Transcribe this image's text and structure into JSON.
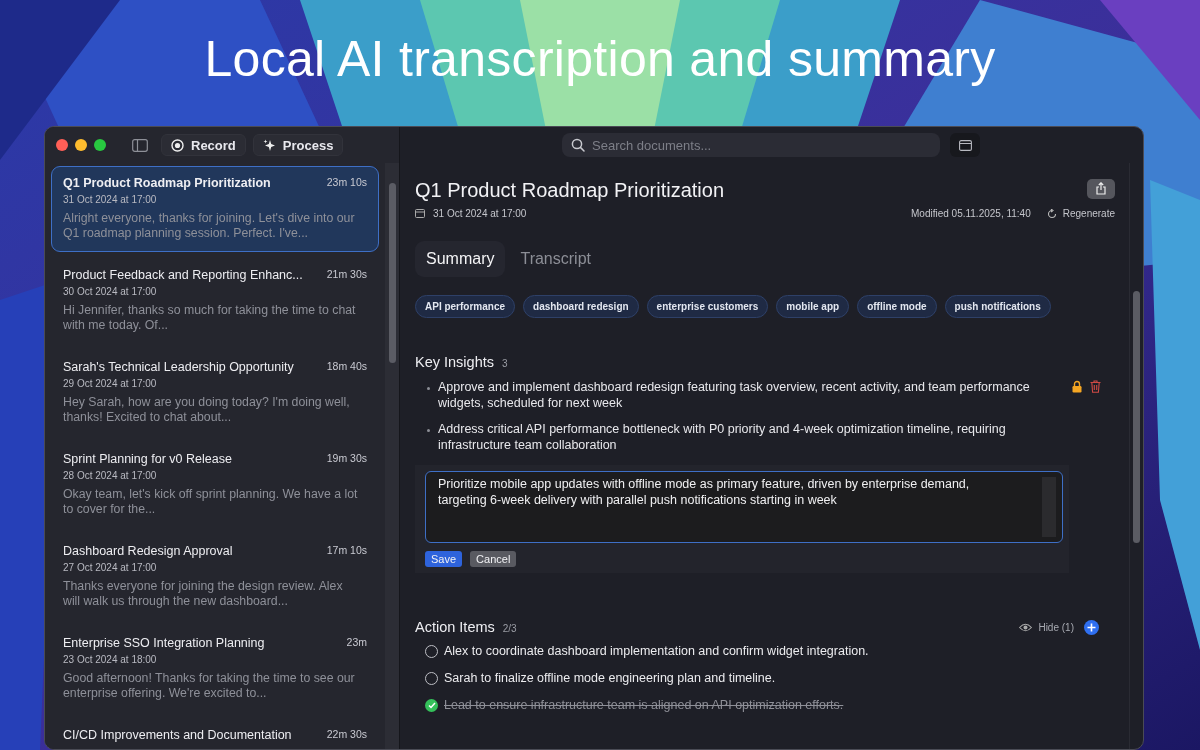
{
  "headline": "Local AI transcription and summary",
  "toolbar": {
    "buttons": [
      {
        "kind": "record",
        "label": "Record"
      },
      {
        "kind": "process",
        "label": "Process"
      }
    ]
  },
  "search": {
    "placeholder": "Search documents..."
  },
  "sidebar": {
    "items": [
      {
        "title": "Q1 Product Roadmap Prioritization",
        "date": "31 Oct 2024 at 17:00",
        "duration": "23m 10s",
        "preview": "Alright everyone, thanks for joining. Let's dive into our Q1 roadmap planning session. Perfect. I've...",
        "selected": true
      },
      {
        "title": "Product Feedback and Reporting Enhanc...",
        "date": "30 Oct 2024 at 17:00",
        "duration": "21m 30s",
        "preview": "Hi Jennifer, thanks so much for taking the time to chat with me today. Of...",
        "selected": false
      },
      {
        "title": "Sarah's Technical Leadership Opportunity",
        "date": "29 Oct 2024 at 17:00",
        "duration": "18m 40s",
        "preview": "Hey Sarah, how are you doing today? I'm doing well, thanks! Excited to chat about...",
        "selected": false
      },
      {
        "title": "Sprint Planning for v0 Release",
        "date": "28 Oct 2024 at 17:00",
        "duration": "19m 30s",
        "preview": "Okay team, let's kick off sprint planning. We have a lot to cover for the...",
        "selected": false
      },
      {
        "title": "Dashboard Redesign Approval",
        "date": "27 Oct 2024 at 17:00",
        "duration": "17m 10s",
        "preview": "Thanks everyone for joining the design review. Alex will walk us through the new dashboard...",
        "selected": false
      },
      {
        "title": "Enterprise SSO Integration Planning",
        "date": "23 Oct 2024 at 18:00",
        "duration": "23m",
        "preview": "Good afternoon! Thanks for taking the time to see our enterprise offering. We're excited to...",
        "selected": false
      },
      {
        "title": "CI/CD Improvements and Documentation",
        "duration": "22m 30s",
        "selected": false
      }
    ]
  },
  "document": {
    "title": "Q1 Product Roadmap Prioritization",
    "date": "31 Oct 2024 at 17:00",
    "modified": "Modified 05.11.2025, 11:40",
    "regenerate": "Regenerate",
    "tabs": [
      {
        "label": "Summary",
        "selected": true
      },
      {
        "label": "Transcript",
        "selected": false
      }
    ],
    "tags": [
      "API performance",
      "dashboard redesign",
      "enterprise customers",
      "mobile app",
      "offline mode",
      "push notifications"
    ],
    "key_insights": {
      "title": "Key Insights",
      "count": "3",
      "items": [
        {
          "text": "Approve and implement dashboard redesign featuring task overview, recent activity, and team performance widgets, scheduled for next week",
          "hovered": true
        },
        {
          "text": "Address critical API performance bottleneck with P0 priority and 4-week optimization timeline, requiring infrastructure team collaboration",
          "hovered": false
        }
      ],
      "editor": {
        "value": "Prioritize mobile app updates with offline mode as primary feature, driven by enterprise demand, targeting 6-week delivery with parallel push notifications starting in week",
        "save": "Save",
        "cancel": "Cancel"
      }
    },
    "action_items": {
      "title": "Action Items",
      "count": "2/3",
      "hide": "Hide",
      "hidden_count": "(1)",
      "items": [
        {
          "text": "Alex to coordinate dashboard implementation and confirm widget integration.",
          "checked": false
        },
        {
          "text": "Sarah to finalize offline mode engineering plan and timeline.",
          "checked": false
        },
        {
          "text": "Lead to ensure infrastructure team is aligned on API optimization efforts.",
          "checked": true
        }
      ]
    }
  }
}
